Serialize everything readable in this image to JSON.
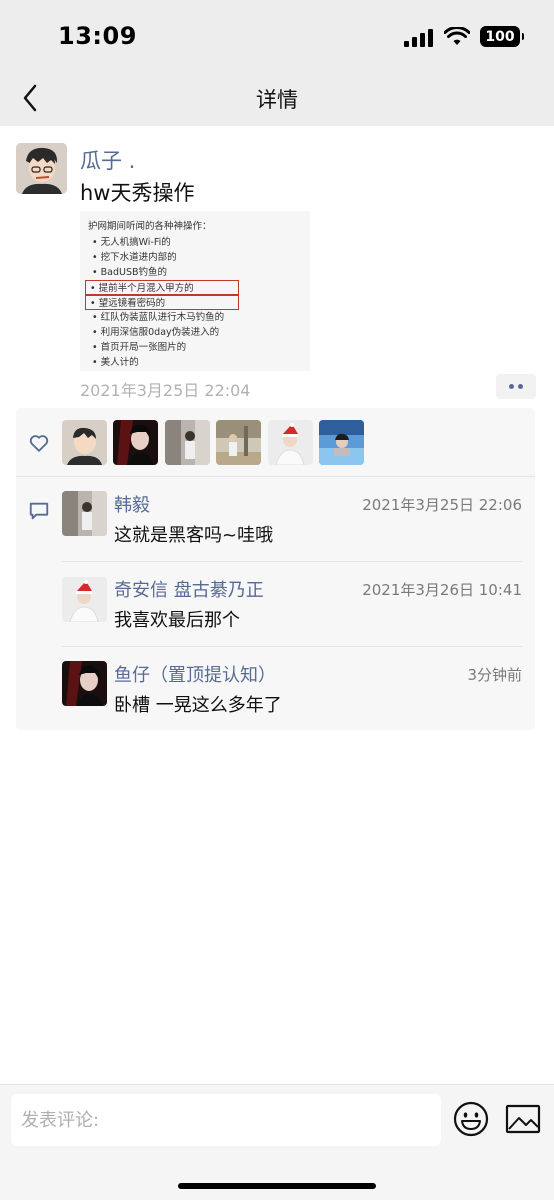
{
  "status_bar": {
    "time": "13:09",
    "battery": "100"
  },
  "nav": {
    "title": "详情"
  },
  "post": {
    "author": "瓜子 .",
    "text": "hw天秀操作",
    "time": "2021年3月25日 22:04",
    "image": {
      "title": "护网期间听闻的各种神操作：",
      "lines": [
        "• 无人机搞Wi-Fi的",
        "• 挖下水道进内部的",
        "• BadUSB钓鱼的",
        "• 提前半个月混入甲方的",
        "• 望远镜看密码的",
        "• 红队伪装蓝队进行木马钓鱼的",
        "• 利用深信服0day伪装进入的",
        "• 首页开局一张图片的",
        "• 美人计的"
      ]
    }
  },
  "likes": {
    "avatars": [
      "cartoon-avatar",
      "dark-portrait-avatar",
      "room-photo-avatar",
      "outdoor-photo-avatar",
      "santa-hat-avatar",
      "pool-photo-avatar"
    ]
  },
  "comments": [
    {
      "name": "韩毅",
      "time": "2021年3月25日 22:06",
      "text": "这就是黑客吗~哇哦"
    },
    {
      "name": "奇安信 盘古綦乃正",
      "time": "2021年3月26日 10:41",
      "text": "我喜欢最后那个"
    },
    {
      "name": "鱼仔（置顶提认知）",
      "time": "3分钟前",
      "text": "卧槽 一晃这么多年了"
    }
  ],
  "input": {
    "placeholder": "发表评论:"
  },
  "colors": {
    "link": "#576b95",
    "nav_bg": "#ededed",
    "box_bg": "#f7f7f7"
  }
}
